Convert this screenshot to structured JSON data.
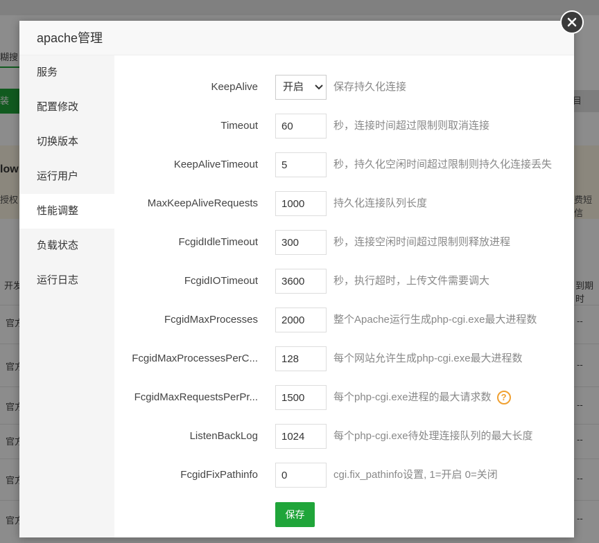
{
  "background": {
    "tab_fragment": "糊搜",
    "green_button_fragment": "装",
    "right_button_fragment": "目",
    "notice_title_fragment": "low",
    "notice_text_fragment": "授权",
    "notice_right_fragment": "费短信",
    "table_header_left": "开发",
    "table_header_right": "到期时",
    "row_left": "官方",
    "row_right": "--"
  },
  "dialog": {
    "title": "apache管理",
    "close_icon": "close-icon",
    "sidebar": {
      "items": [
        {
          "label": "服务"
        },
        {
          "label": "配置修改"
        },
        {
          "label": "切换版本"
        },
        {
          "label": "运行用户"
        },
        {
          "label": "性能调整",
          "active": true
        },
        {
          "label": "负载状态"
        },
        {
          "label": "运行日志"
        }
      ]
    },
    "settings": [
      {
        "label": "KeepAlive",
        "value": "开启",
        "type": "select",
        "desc": "保存持久化连接"
      },
      {
        "label": "Timeout",
        "value": "60",
        "desc": "秒，连接时间超过限制则取消连接"
      },
      {
        "label": "KeepAliveTimeout",
        "value": "5",
        "desc": "秒，持久化空闲时间超过限制则持久化连接丢失"
      },
      {
        "label": "MaxKeepAliveRequests",
        "value": "1000",
        "desc": "持久化连接队列长度"
      },
      {
        "label": "FcgidIdleTimeout",
        "value": "300",
        "desc": "秒，连接空闲时间超过限制则释放进程"
      },
      {
        "label": "FcgidIOTimeout",
        "value": "3600",
        "desc": "秒，执行超时，上传文件需要调大"
      },
      {
        "label": "FcgidMaxProcesses",
        "value": "2000",
        "desc": "整个Apache运行生成php-cgi.exe最大进程数"
      },
      {
        "label": "FcgidMaxProcessesPerC...",
        "value": "128",
        "desc": "每个网站允许生成php-cgi.exe最大进程数"
      },
      {
        "label": "FcgidMaxRequestsPerPr...",
        "value": "1500",
        "desc": "每个php-cgi.exe进程的最大请求数",
        "help": "?"
      },
      {
        "label": "ListenBackLog",
        "value": "1024",
        "desc": "每个php-cgi.exe待处理连接队列的最大长度"
      },
      {
        "label": "FcgidFixPathinfo",
        "value": "0",
        "desc": "cgi.fix_pathinfo设置, 1=开启 0=关闭"
      }
    ],
    "save_label": "保存"
  },
  "colors": {
    "accent": "#20a53a",
    "help": "#f0a030"
  }
}
